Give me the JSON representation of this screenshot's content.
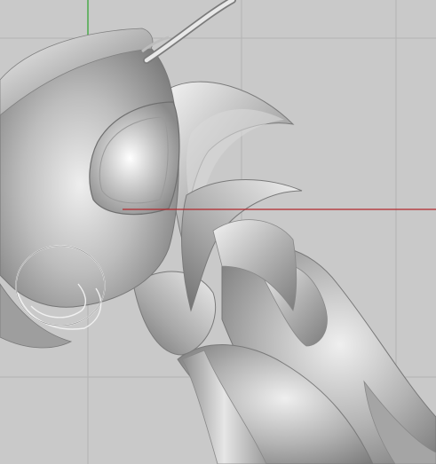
{
  "viewport": {
    "background": "#c9c9c9",
    "grid_color": "#b4b4b4",
    "x_axis_color": "#b3282d",
    "y_axis_color": "#2aa32a",
    "model_base_color": "#a9a9a9",
    "model_highlight_color": "#f4f4f4",
    "model_shadow_color": "#6f6f6f"
  },
  "model": {
    "parts": [
      "insect-head",
      "compound-eye",
      "antenna",
      "mandible-coil",
      "thorax-plate-upper",
      "thorax-plate-lower",
      "leg-segment",
      "abdomen-segment"
    ]
  }
}
